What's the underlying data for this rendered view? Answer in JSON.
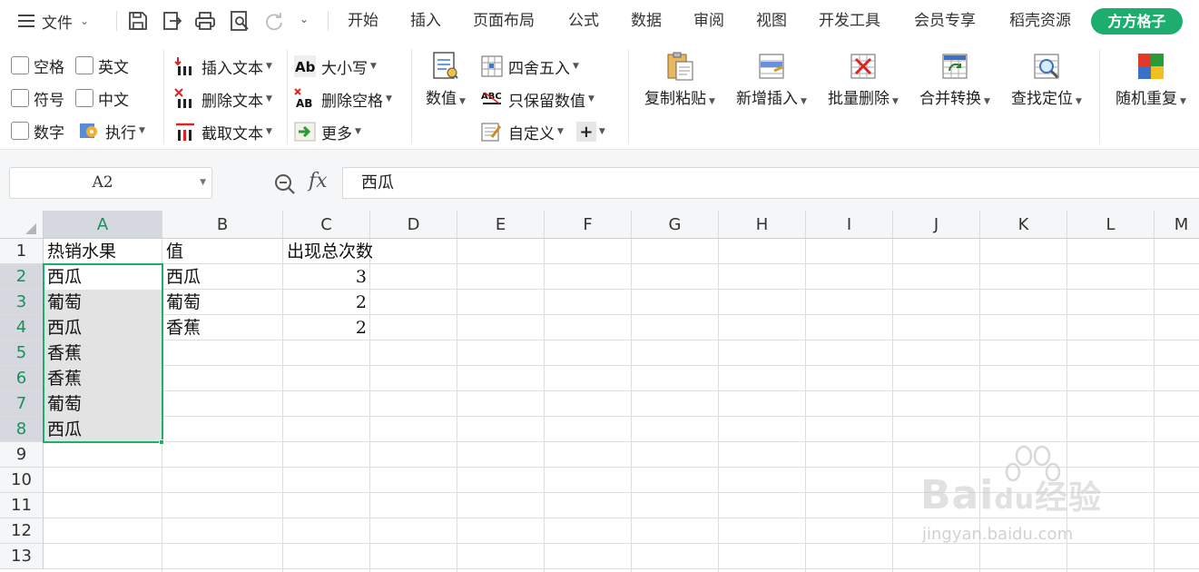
{
  "menubar": {
    "main_menu": "文件",
    "tabs": [
      "开始",
      "插入",
      "页面布局",
      "公式",
      "数据",
      "审阅",
      "视图",
      "开发工具",
      "会员专享",
      "稻壳资源"
    ],
    "active_tab": "方方格子"
  },
  "ribbon": {
    "checkboxes": [
      "空格",
      "英文",
      "符号",
      "中文",
      "数字"
    ],
    "execute": "执行",
    "text_tools": [
      "插入文本",
      "删除文本",
      "截取文本"
    ],
    "case_tools": [
      "大小写",
      "删除空格",
      "更多"
    ],
    "value_btn": "数值",
    "number_tools": [
      "四舍五入",
      "只保留数值",
      "自定义"
    ],
    "big_buttons": [
      "复制粘贴",
      "新增插入",
      "批量删除",
      "合并转换",
      "查找定位",
      "随机重复"
    ]
  },
  "formula_bar": {
    "name_box": "A2",
    "fx": "fx",
    "content": "西瓜"
  },
  "grid": {
    "columns": [
      "A",
      "B",
      "C",
      "D",
      "E",
      "F",
      "G",
      "H",
      "I",
      "J",
      "K",
      "L",
      "M"
    ],
    "rows": [
      "1",
      "2",
      "3",
      "4",
      "5",
      "6",
      "7",
      "8",
      "9",
      "10",
      "11",
      "12",
      "13"
    ],
    "col_a": [
      "热销水果",
      "西瓜",
      "葡萄",
      "西瓜",
      "香蕉",
      "香蕉",
      "葡萄",
      "西瓜"
    ],
    "col_b": [
      "值",
      "西瓜",
      "葡萄",
      "香蕉"
    ],
    "col_c": [
      "出现总次数",
      "3",
      "2",
      "2"
    ]
  },
  "watermark": {
    "brand": "Bai",
    "brand2": "du",
    "suffix": "经验",
    "url": "jingyan.baidu.com"
  },
  "colors": {
    "accent": "#1dae6e",
    "selection": "#e3e3e3",
    "header_sel": "#d5d8de"
  }
}
